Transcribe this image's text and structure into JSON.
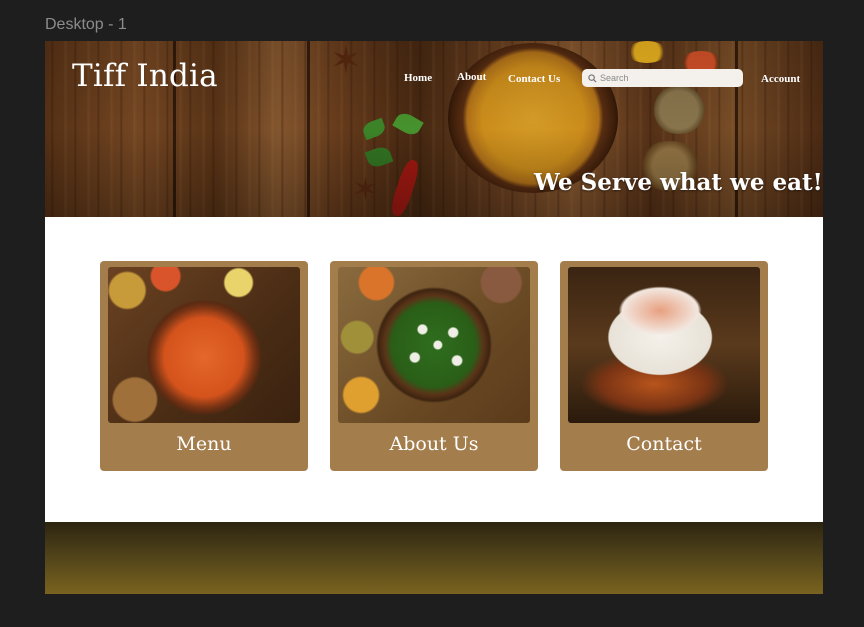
{
  "frame": {
    "label": "Desktop - 1"
  },
  "header": {
    "brand": "Tiff India",
    "nav": [
      "Home",
      "About",
      "Contact Us"
    ],
    "search_placeholder": "Search",
    "account_label": "Account",
    "tagline": "We Serve what we eat!"
  },
  "cards": [
    {
      "label": "Menu"
    },
    {
      "label": "About Us"
    },
    {
      "label": "Contact"
    }
  ],
  "colors": {
    "card": "#a47d4d",
    "footer_top": "#2c2410",
    "footer_bottom": "#7a6320"
  }
}
